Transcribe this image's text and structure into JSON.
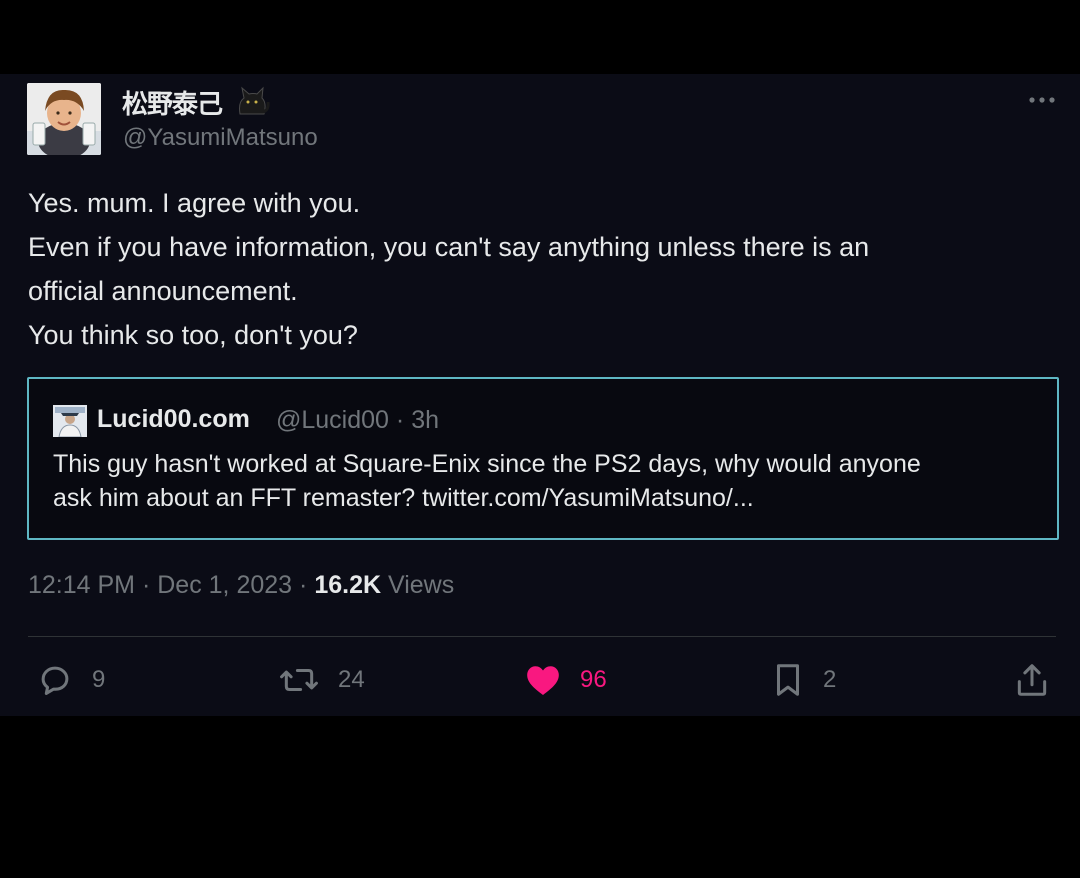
{
  "tweet": {
    "author": {
      "display_name": "松野泰己",
      "handle": "@YasumiMatsuno",
      "badge_icon": "black-cat-icon"
    },
    "more_icon": "more-dots-icon",
    "text_lines": [
      "Yes. mum. I agree with you.",
      "Even if you have information, you can't say anything unless there is an",
      "official announcement.",
      "You think so too, don't you?"
    ],
    "quote": {
      "author_name": "Lucid00.com",
      "handle": "@Lucid00",
      "separator": "·",
      "time": "3h",
      "text_lines": [
        "This guy hasn't worked at Square-Enix since the PS2 days, why would anyone",
        "ask him about an FFT remaster? twitter.com/YasumiMatsuno/..."
      ],
      "border_color": "#5fb7c4"
    },
    "meta": {
      "time": "12:14 PM",
      "separator": "·",
      "date": "Dec 1, 2023",
      "views_count": "16.2K",
      "views_label": "Views"
    },
    "actions": {
      "reply": {
        "icon": "reply-icon",
        "count": "9"
      },
      "retweet": {
        "icon": "retweet-icon",
        "count": "24"
      },
      "like": {
        "icon": "heart-icon",
        "count": "96",
        "liked": true,
        "color": "#f91880"
      },
      "bookmark": {
        "icon": "bookmark-icon",
        "count": "2"
      },
      "share": {
        "icon": "share-icon"
      }
    }
  },
  "colors": {
    "background": "#000000",
    "card": "#0b0c16",
    "text": "#e7e9ea",
    "muted": "#71767b",
    "like": "#f91880"
  }
}
